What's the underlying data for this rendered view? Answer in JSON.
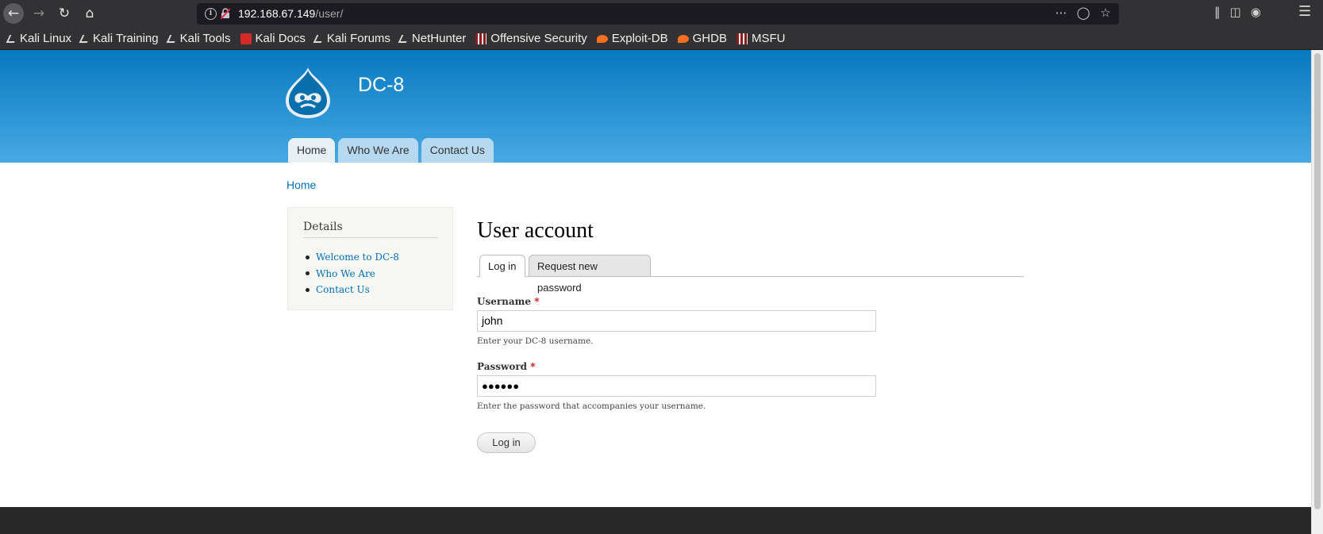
{
  "browser": {
    "url_host": "192.168.67.149",
    "url_path": "/user/",
    "bookmarks": [
      {
        "label": "Kali Linux",
        "icon": "kali-icon"
      },
      {
        "label": "Kali Training",
        "icon": "kali-icon"
      },
      {
        "label": "Kali Tools",
        "icon": "kali-icon"
      },
      {
        "label": "Kali Docs",
        "icon": "kali-docs-icon"
      },
      {
        "label": "Kali Forums",
        "icon": "kali-icon"
      },
      {
        "label": "NetHunter",
        "icon": "kali-icon"
      },
      {
        "label": "Offensive Security",
        "icon": "offsec-icon"
      },
      {
        "label": "Exploit-DB",
        "icon": "exploit-db-icon"
      },
      {
        "label": "GHDB",
        "icon": "exploit-db-icon"
      },
      {
        "label": "MSFU",
        "icon": "offsec-icon"
      }
    ]
  },
  "site": {
    "name": "DC-8",
    "menu": [
      "Home",
      "Who We Are",
      "Contact Us"
    ]
  },
  "breadcrumb": "Home",
  "sidebar": {
    "title": "Details",
    "links": [
      "Welcome to DC-8",
      "Who We Are",
      "Contact Us"
    ]
  },
  "main": {
    "title": "User account",
    "tabs": [
      "Log in",
      "Request new password"
    ],
    "username_label": "Username",
    "username_value": "john",
    "username_desc": "Enter your DC-8 username.",
    "password_label": "Password",
    "password_masked": "●●●●●●",
    "password_desc": "Enter the password that accompanies your username.",
    "required_marker": "*",
    "submit_label": "Log in"
  },
  "colors": {
    "header_top": "#0779bf",
    "header_bottom": "#48a9e4",
    "link": "#0071b3",
    "footer": "#292929"
  }
}
